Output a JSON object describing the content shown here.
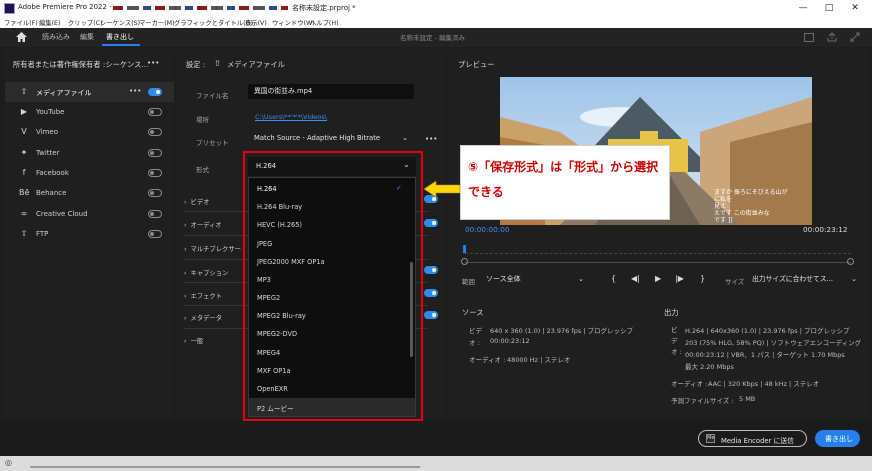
{
  "window": {
    "title": "Adobe Premiere Pro 2022 - ",
    "title_suffix": "名称未設定.prproj *",
    "controls": {
      "minimize": "—",
      "maximize": "□",
      "close": "✕"
    }
  },
  "menu": [
    "ファイル(F)",
    "編集(E)",
    "クリップ(C)",
    "シーケンス(S)",
    "マーカー(M)",
    "グラフィックとタイトル(G)",
    "表示(V)",
    "ウィンドウ(W)",
    "ヘルプ(H)"
  ],
  "tabs": {
    "import": "読み込み",
    "edit": "編集",
    "export": "書き出し",
    "center": "名称未設定 - 編集済み"
  },
  "left_panel": {
    "header": "所有者または著作権保有者 :シーケンス...",
    "more": "•••",
    "items": [
      {
        "label": "メディアファイル",
        "icon": "export-icon",
        "on": true
      },
      {
        "label": "YouTube",
        "icon": "youtube-icon",
        "on": false
      },
      {
        "label": "Vimeo",
        "icon": "vimeo-icon",
        "on": false
      },
      {
        "label": "Twitter",
        "icon": "twitter-icon",
        "on": false
      },
      {
        "label": "Facebook",
        "icon": "facebook-icon",
        "on": false
      },
      {
        "label": "Behance",
        "icon": "behance-icon",
        "on": false
      },
      {
        "label": "Creative Cloud",
        "icon": "creative-cloud-icon",
        "on": false
      },
      {
        "label": "FTP",
        "icon": "ftp-icon",
        "on": false
      }
    ]
  },
  "settings": {
    "header": "設定 :",
    "header_target": "メディアファイル",
    "filename_label": "ファイル名",
    "filename": "異国の街並み.mp4",
    "location_label": "場所",
    "location": "C:\\Users\\**'*'*\\Videos\\",
    "preset_label": "プリセット",
    "preset": "Match Source - Adaptive High Bitrate",
    "format_label": "形式",
    "format": "H.264",
    "sections": [
      "ビデオ",
      "オーディオ",
      "マルチプレクサー",
      "キャプション",
      "エフェクト",
      "メタデータ",
      "一般"
    ]
  },
  "format_options": [
    "H.264",
    "H.264 Blu-ray",
    "HEVC (H.265)",
    "JPEG",
    "JPEG2000 MXF OP1a",
    "MP3",
    "MPEG2",
    "MPEG2 Blu-ray",
    "MPEG2-DVD",
    "MPEG4",
    "MXF OP1a",
    "OpenEXR",
    "P2 ムービー"
  ],
  "callout": {
    "text": "⑤「保存形式」は「形式」から選択できる"
  },
  "preview": {
    "label": "プレビュー",
    "caption_line1": "ますか 振ろにそびえる山が",
    "caption_line2": "に私を",
    "caption_line3": "見え",
    "caption_line4": "えです  この街並みな",
    "caption_line5": "です  ]]",
    "timecode_start": "00:00:00:00",
    "timecode_end": "00:00:23:12",
    "range_label": "範囲",
    "range_value": "ソース全体",
    "size_label": "サイズ",
    "size_value": "出力サイズに合わせてス..."
  },
  "source": {
    "title": "ソース",
    "video_label": "ビデ\nオ :",
    "video_value": "640 x 360 (1.0) | 23.976 fps | プログレッシブ",
    "video_duration": "00:00:23:12",
    "audio_label": "オーディオ :",
    "audio_value": "48000 Hz | ステレオ"
  },
  "output": {
    "title": "出力",
    "video_label": "ビ\nデ\nオ :",
    "line1": "H.264 | 640x360 (1.0) | 23.976 fps | プログレッシブ",
    "line2": "203 (75% HLG, 58% PQ) | ソフトウェアエンコーディング",
    "line3": "00:00:23:12 | VBR、1 パス | ターゲット 1.70 Mbps",
    "line4": "最大 2.20 Mbps",
    "audio_label": "オーディオ :",
    "audio_value": "AAC | 320 Kbps | 48 kHz | ステレオ",
    "size_label": "予測ファイルサイズ :",
    "size_value": "5 MB"
  },
  "buttons": {
    "media_encoder": "Media Encoder に送信",
    "export": "書き出し"
  },
  "colors": {
    "accent": "#2680eb",
    "highlight_red": "#e60012",
    "callout_arrow": "#ffd600"
  }
}
